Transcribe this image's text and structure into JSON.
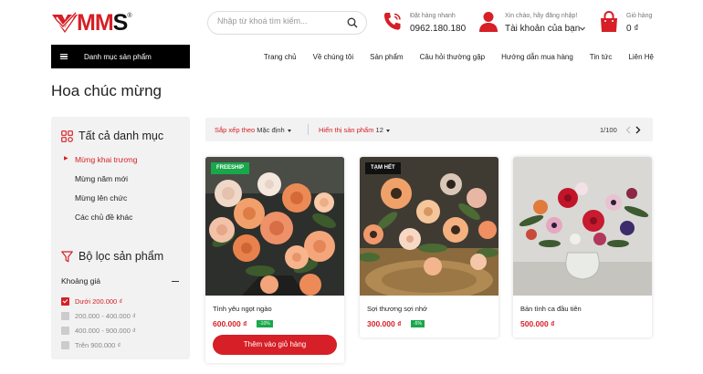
{
  "header": {
    "logo_text": "MMS",
    "logo_reg": "®",
    "search_placeholder": "Nhập từ khoá tìm kiếm...",
    "hotline_label": "Đặt hàng nhanh",
    "hotline_number": "0962.180.180",
    "account_label": "Xin chào, hãy đăng nhập!",
    "account_name": "Tài khoản của bạn",
    "cart_label": "Giỏ hàng",
    "cart_total": "0 ₫"
  },
  "nav": {
    "category_button": "Danh mục sản phẩm",
    "items": [
      "Trang chủ",
      "Về chúng tôi",
      "Sản phẩm",
      "Câu hỏi thường gặp",
      "Hướng dẫn mua hàng",
      "Tin tức",
      "Liên Hệ"
    ]
  },
  "page_title": "Hoa chúc mừng",
  "sidebar": {
    "all_categories_title": "Tất cả danh mục",
    "categories": [
      "Mừng khai trương",
      "Mừng năm mới",
      "Mừng lên chức",
      "Các chủ đề khác"
    ],
    "filter_title": "Bộ lọc sản phẩm",
    "price_label": "Khoảng giá",
    "price_options": [
      "Dưới 200.000 ₫",
      "200.000 - 400.000 ₫",
      "400.000 - 900.000 ₫",
      "Trên 900.000 ₫"
    ],
    "price_selected_index": 0
  },
  "toolbar": {
    "sort_label": "Sắp xếp theo",
    "sort_value": "Mặc định",
    "show_label": "Hiển thị sản phẩm",
    "show_value": "12",
    "pagination": "1/100"
  },
  "products": [
    {
      "badge": "FREESHIP",
      "badge_color": "#18a84a",
      "name": "Tình yêu ngọt ngào",
      "price": "600.000 ₫",
      "discount": "-10%",
      "button": "Thêm vào giỏ hàng"
    },
    {
      "badge": "TẠM HẾT",
      "badge_color": "#111111",
      "name": "Sợi thương sợi nhớ",
      "price": "300.000 ₫",
      "discount": "-5%"
    },
    {
      "name": "Bản tình ca đầu tiên",
      "price": "500.000 ₫"
    }
  ],
  "colors": {
    "accent": "#d61f26",
    "discount_green": "#18a84a",
    "panel_bg": "#f2f2f2"
  }
}
